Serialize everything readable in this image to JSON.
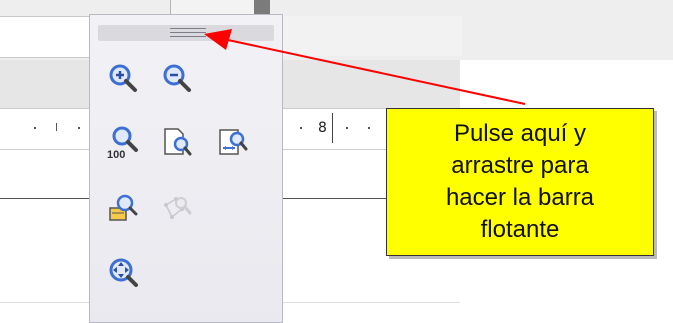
{
  "ruler": {
    "number": "8"
  },
  "toolbar": {
    "buttons": [
      {
        "name": "zoom-in",
        "icon": "zoom-in-icon",
        "enabled": true
      },
      {
        "name": "zoom-out",
        "icon": "zoom-out-icon",
        "enabled": true
      },
      {
        "name": "zoom-100",
        "icon": "zoom-100-icon",
        "label": "100",
        "enabled": true
      },
      {
        "name": "entire-page",
        "icon": "entire-page-icon",
        "enabled": true
      },
      {
        "name": "page-width",
        "icon": "page-width-icon",
        "enabled": true
      },
      {
        "name": "optimal-view",
        "icon": "optimal-view-icon",
        "enabled": true
      },
      {
        "name": "object-zoom",
        "icon": "object-zoom-icon",
        "enabled": false
      },
      {
        "name": "shift",
        "icon": "shift-icon",
        "enabled": true
      }
    ]
  },
  "callout": {
    "text": "Pulse aquí y\narrastre para\nhacer la barra\nflotante",
    "background": "#ffff00"
  },
  "colors": {
    "arrow": "#ff0000",
    "magnifier_blue": "#3e6fd2"
  }
}
